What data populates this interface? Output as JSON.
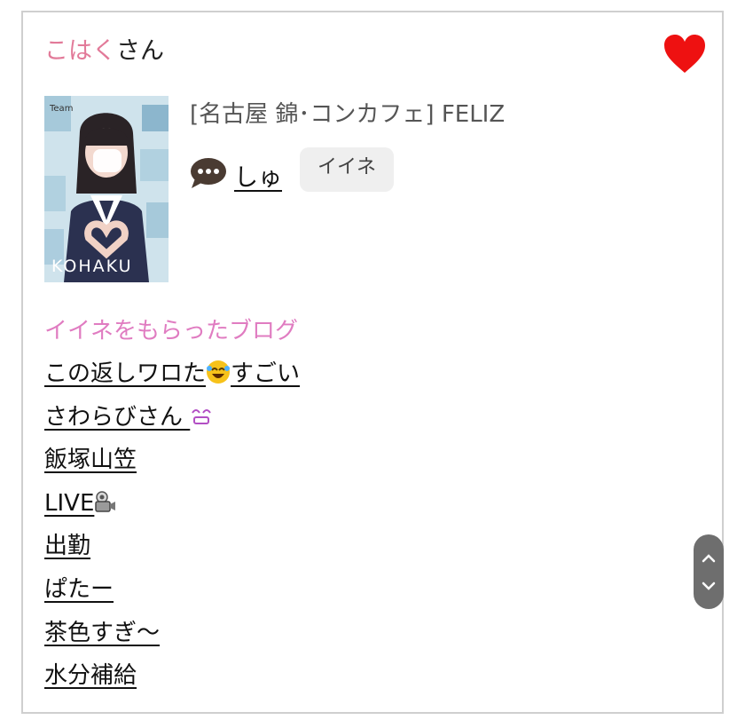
{
  "header": {
    "name_highlight": "こはく",
    "name_suffix": "さん",
    "favorite_icon": "heart-icon",
    "favorite_color": "#ee1111"
  },
  "photo": {
    "caption": "KOHAKU",
    "team_text": "Team"
  },
  "shop": {
    "name": "[名古屋 錦･コンカフェ]  FELIZ"
  },
  "cast": {
    "icon": "speech-bubble-icon",
    "name": "しゅ",
    "iine_button": "イイネ"
  },
  "blogs": {
    "title": "イイネをもらったブログ",
    "title_color": "#e07cc1",
    "items": [
      {
        "before": "この返しワロた",
        "emoji": "laughing-emoji",
        "after": "すごい"
      },
      {
        "before": "さわらびさん",
        "emoji": "smile-emoji",
        "after": ""
      },
      {
        "before": "飯塚山笠",
        "emoji": "",
        "after": ""
      },
      {
        "before": "LIVE",
        "emoji": "camera-emoji",
        "after": ""
      },
      {
        "before": "出勤",
        "emoji": "",
        "after": ""
      },
      {
        "before": "ぱたー",
        "emoji": "",
        "after": ""
      },
      {
        "before": "茶色すぎ〜",
        "emoji": "",
        "after": ""
      },
      {
        "before": "水分補給",
        "emoji": "",
        "after": ""
      }
    ]
  },
  "colors": {
    "accent_pink": "#e27a99",
    "border": "#cfcfcf",
    "button_bg": "#efefef",
    "scroll_bg": "#6e6e6e"
  }
}
